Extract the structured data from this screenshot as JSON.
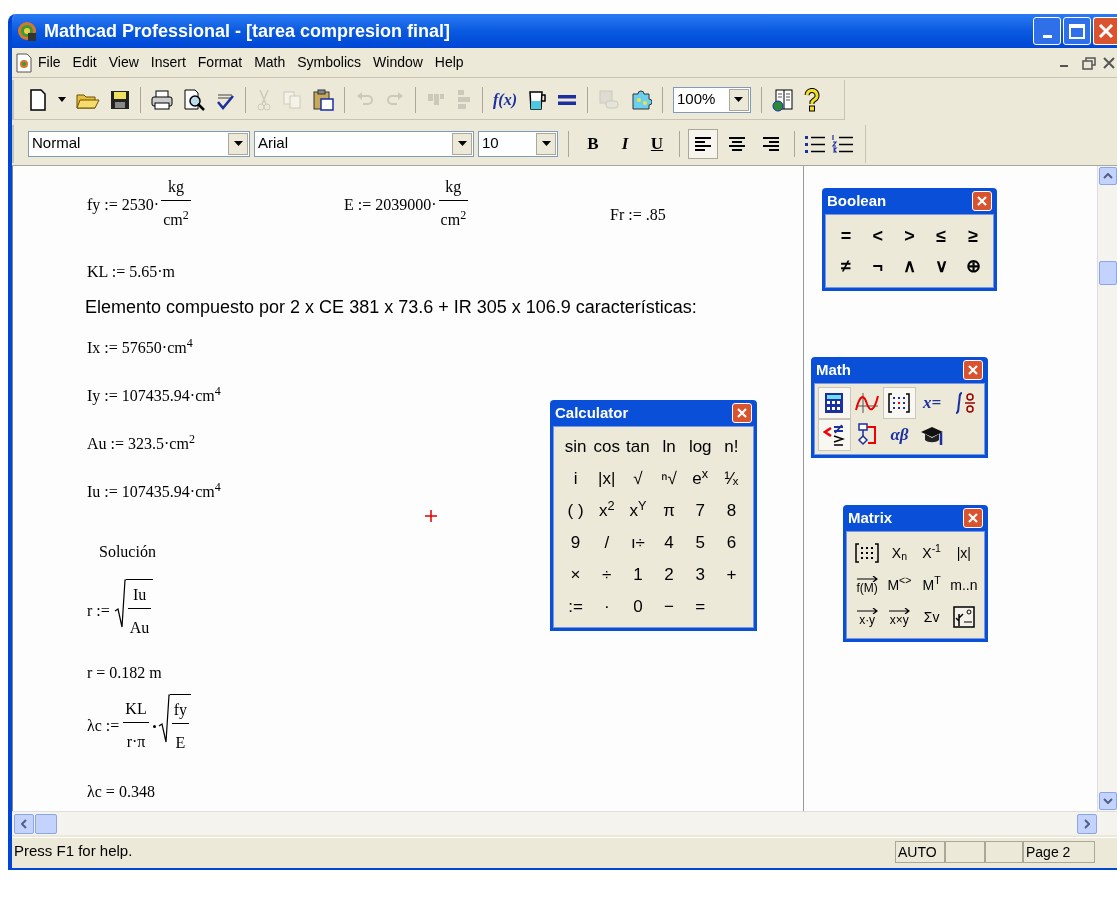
{
  "window": {
    "title": "Mathcad Professional - [tarea compresion final]"
  },
  "menu": [
    "File",
    "Edit",
    "View",
    "Insert",
    "Format",
    "Math",
    "Symbolics",
    "Window",
    "Help"
  ],
  "toolbar": [
    {
      "kind": "new",
      "disabled": false
    },
    {
      "kind": "caret",
      "disabled": false
    },
    {
      "kind": "open",
      "disabled": false
    },
    {
      "kind": "save",
      "disabled": false
    },
    {
      "kind": "separator"
    },
    {
      "kind": "print",
      "disabled": false
    },
    {
      "kind": "preview",
      "disabled": false
    },
    {
      "kind": "spell",
      "disabled": false
    },
    {
      "kind": "separator"
    },
    {
      "kind": "cut",
      "disabled": true
    },
    {
      "kind": "copy",
      "disabled": true
    },
    {
      "kind": "paste",
      "disabled": false
    },
    {
      "kind": "separator"
    },
    {
      "kind": "undo",
      "disabled": true
    },
    {
      "kind": "redo",
      "disabled": true
    },
    {
      "kind": "separator"
    },
    {
      "kind": "align_across",
      "disabled": true
    },
    {
      "kind": "align_down",
      "disabled": true
    },
    {
      "kind": "separator"
    },
    {
      "kind": "text",
      "label": "f(x)",
      "disabled": false
    },
    {
      "kind": "units",
      "disabled": false
    },
    {
      "kind": "equals",
      "disabled": false
    },
    {
      "kind": "separator"
    },
    {
      "kind": "component",
      "disabled": true
    },
    {
      "kind": "resource",
      "disabled": false
    },
    {
      "kind": "separator"
    },
    {
      "kind": "combo",
      "value": "100%"
    },
    {
      "kind": "separator"
    },
    {
      "kind": "book",
      "disabled": false
    },
    {
      "kind": "help",
      "disabled": false
    }
  ],
  "format_bar": {
    "style": "Normal",
    "font": "Arial",
    "size": "10",
    "emphasis": [
      "B",
      "I",
      "U"
    ],
    "alignment": [
      {
        "kind": "left",
        "selected": true
      },
      {
        "kind": "center",
        "selected": false
      },
      {
        "kind": "right",
        "selected": false
      }
    ],
    "lists": [
      {
        "kind": "bullets"
      },
      {
        "kind": "numbers"
      }
    ]
  },
  "worksheet": {
    "regions": [
      {
        "kind": "fraction",
        "lhs": "fy := 2530·",
        "num": "kg",
        "den": "cm$^{2}$"
      },
      {
        "kind": "fraction",
        "lhs": "E := 2039000·",
        "num": "kg",
        "den": "cm$^{2}$"
      },
      {
        "kind": "math",
        "text": "Fr := .85"
      },
      {
        "kind": "math",
        "text": "KL := 5.65·m"
      },
      {
        "kind": "text",
        "text": "Elemento compuesto por 2 x CE 381 x 73.6 + IR 305 x 106.9  características:"
      },
      {
        "kind": "math",
        "text": "Ix := 57650·cm$^{4}$"
      },
      {
        "kind": "math",
        "text": "Iy := 107435.94·cm$^{4}$"
      },
      {
        "kind": "math",
        "text": "Au := 323.5·cm$^{2}$"
      },
      {
        "kind": "math",
        "text": "Iu := 107435.94·cm$^{4}$"
      },
      {
        "kind": "math",
        "text": "Solución"
      },
      {
        "kind": "sqrt",
        "lhs": "r :=",
        "num": "Iu",
        "den": "Au"
      },
      {
        "kind": "math",
        "text": "r = 0.182 m"
      },
      {
        "kind": "product",
        "lhs": "λc :=",
        "num": "KL",
        "den": "r·π",
        "rnum": "fy",
        "rden": "E"
      },
      {
        "kind": "math",
        "text": "λc = 0.348"
      }
    ]
  },
  "calculator": {
    "title": "Calculator",
    "keys": [
      "sin",
      "cos",
      "tan",
      "ln",
      "log",
      "n!",
      "i",
      "|x|",
      "√",
      "ⁿ√",
      "e$^{x}$",
      "¹⁄ₓ",
      "( )",
      "x$^{2}$",
      "x$^{Y}$",
      "π",
      "7",
      "8",
      "9",
      "/",
      "ı÷",
      "4",
      "5",
      "6",
      "×",
      "÷",
      "1",
      "2",
      "3",
      "+",
      ":=",
      "·",
      "0",
      "−",
      "="
    ]
  },
  "boolean": {
    "title": "Boolean",
    "keys": [
      "=",
      "<",
      ">",
      "≤",
      "≥",
      "≠",
      "¬",
      "∧",
      "∨",
      "⊕"
    ]
  },
  "math_palette": {
    "title": "Math",
    "buttons": [
      {
        "kind": "calculator",
        "selected": true
      },
      {
        "kind": "graph",
        "selected": false
      },
      {
        "kind": "matrix",
        "selected": true
      },
      {
        "kind": "text",
        "label": "x=",
        "selected": false
      },
      {
        "kind": "calculus",
        "selected": false
      },
      {
        "kind": "boolean",
        "selected": true
      },
      {
        "kind": "programming",
        "selected": false
      },
      {
        "kind": "text",
        "label": "αβ",
        "selected": false
      },
      {
        "kind": "symbolic",
        "selected": false
      }
    ]
  },
  "matrix_palette": {
    "title": "Matrix",
    "buttons": [
      {
        "kind": "matrix"
      },
      {
        "kind": "text",
        "label": "X$_{n}$"
      },
      {
        "kind": "text",
        "label": "X$^{-1}$"
      },
      {
        "kind": "text",
        "label": "|x|"
      },
      {
        "kind": "vector",
        "label": "f(M)"
      },
      {
        "kind": "text",
        "label": "M$^{<>}$"
      },
      {
        "kind": "text",
        "label": "M$^{T}$"
      },
      {
        "kind": "text",
        "label": "m..n"
      },
      {
        "kind": "vector",
        "label": "x·y"
      },
      {
        "kind": "vector",
        "label": "x×y"
      },
      {
        "kind": "text",
        "label": "Σv"
      },
      {
        "kind": "picture"
      }
    ]
  },
  "status_bar": {
    "message": "Press F1 for help.",
    "mode": "AUTO",
    "page": "Page 2"
  }
}
